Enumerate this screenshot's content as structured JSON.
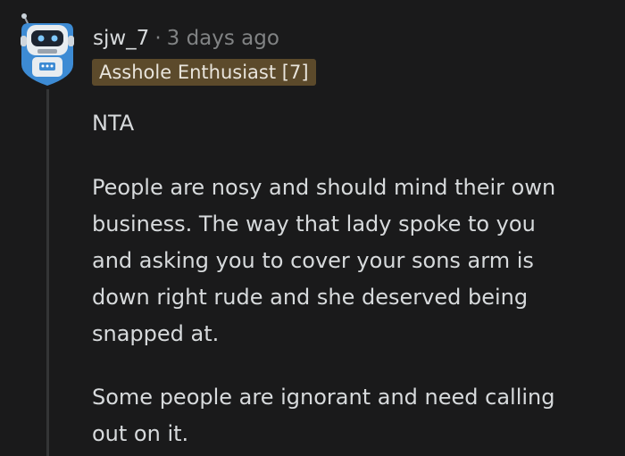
{
  "comment": {
    "username": "sjw_7",
    "separator": "·",
    "timestamp": "3 days ago",
    "flair": "Asshole Enthusiast [7]",
    "paragraphs": [
      [
        "NTA"
      ],
      [
        "People are nosy and should mind their own",
        "business. The way that lady spoke to you",
        "and asking you to cover your sons arm is",
        "down right rude and she deserved being",
        "snapped at."
      ],
      [
        "Some people are ignorant and need calling",
        "out on it."
      ]
    ]
  },
  "avatar": {
    "icon": "robot-avatar-icon"
  },
  "colors": {
    "background": "#1a1a1b",
    "text": "#d7dadc",
    "muted": "#818384",
    "flair_bg": "#5c4a2b",
    "thread_line": "#343536"
  }
}
